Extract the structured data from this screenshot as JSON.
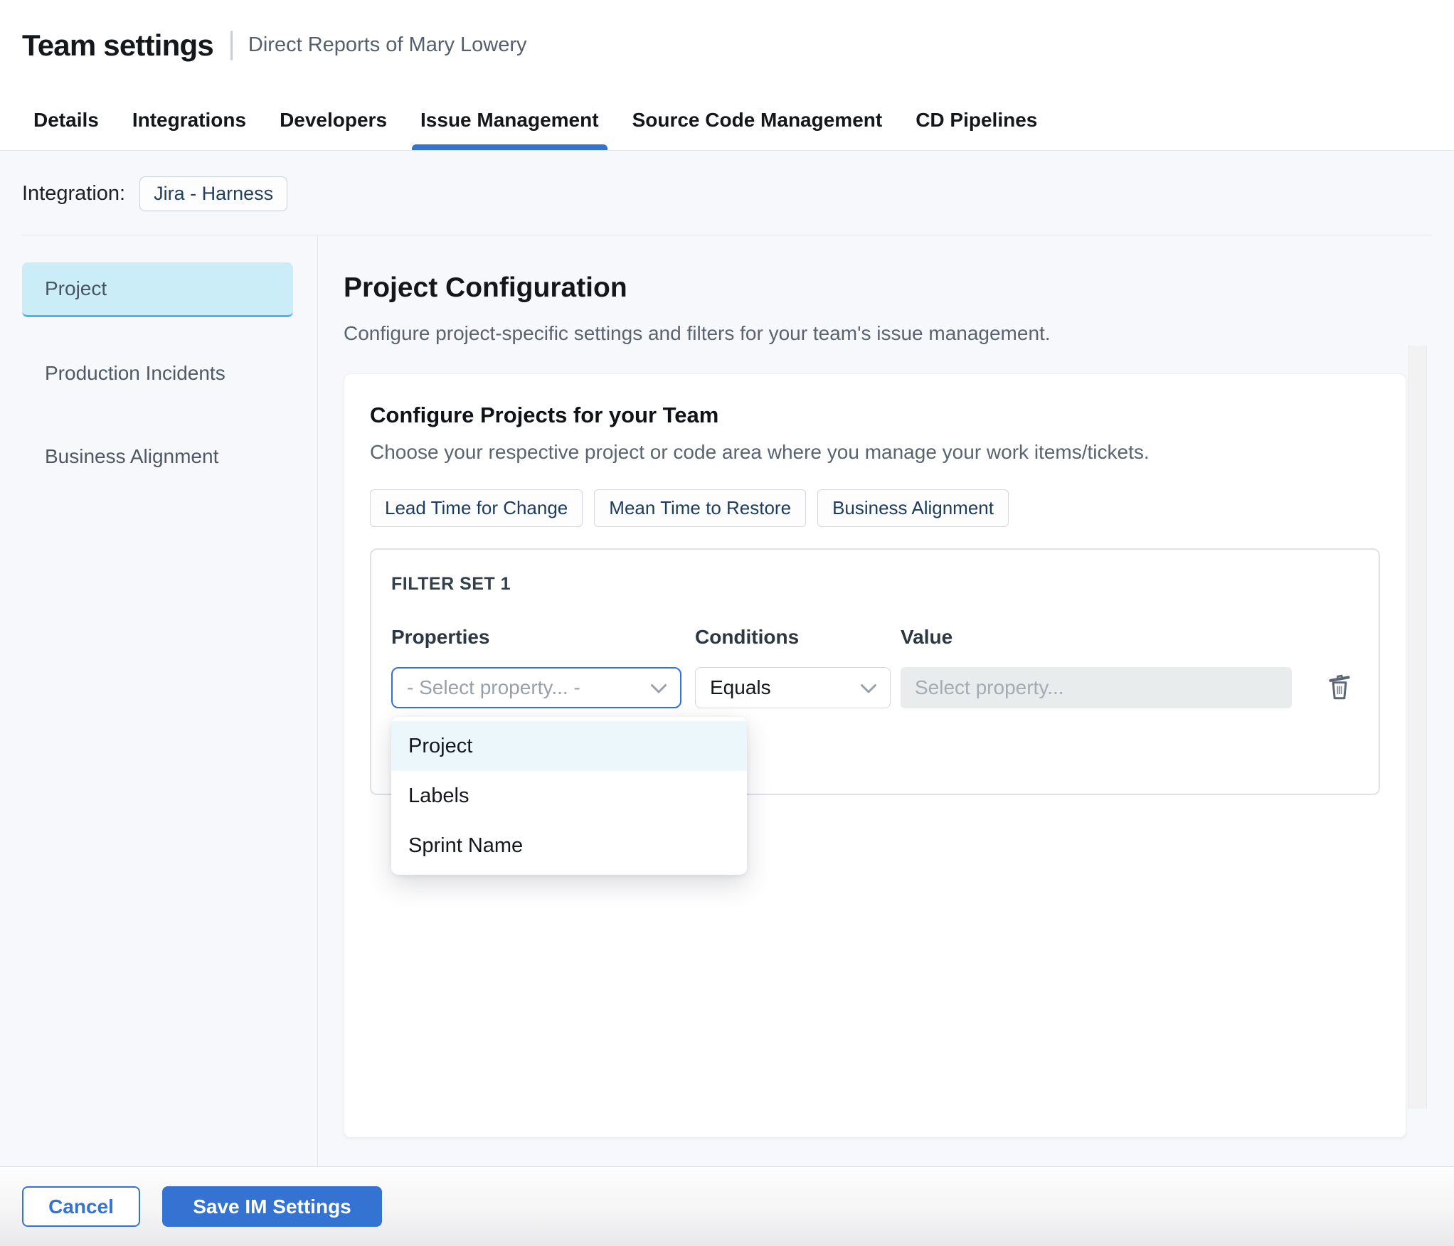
{
  "header": {
    "title": "Team settings",
    "subtitle": "Direct Reports of Mary Lowery"
  },
  "tabs": [
    {
      "label": "Details",
      "active": false
    },
    {
      "label": "Integrations",
      "active": false
    },
    {
      "label": "Developers",
      "active": false
    },
    {
      "label": "Issue Management",
      "active": true
    },
    {
      "label": "Source Code Management",
      "active": false
    },
    {
      "label": "CD Pipelines",
      "active": false
    }
  ],
  "integration": {
    "label": "Integration:",
    "chip": "Jira - Harness"
  },
  "sidebar": {
    "items": [
      {
        "label": "Project",
        "active": true
      },
      {
        "label": "Production Incidents",
        "active": false
      },
      {
        "label": "Business Alignment",
        "active": false
      }
    ]
  },
  "main": {
    "title": "Project Configuration",
    "subtitle": "Configure project-specific settings and filters for your team's issue management.",
    "card": {
      "title": "Configure Projects for your Team",
      "subtitle": "Choose your respective project or code area where you manage your work items/tickets.",
      "chips": [
        "Lead Time for Change",
        "Mean Time to Restore",
        "Business Alignment"
      ],
      "filter": {
        "title": "FILTER SET 1",
        "columns": [
          "Properties",
          "Conditions",
          "Value"
        ],
        "properties_placeholder": "- Select property... -",
        "conditions_value": "Equals",
        "value_placeholder": "Select property...",
        "dropdown": {
          "items": [
            "Project",
            "Labels",
            "Sprint Name"
          ],
          "highlighted": "Project"
        }
      }
    }
  },
  "footer": {
    "cancel_label": "Cancel",
    "save_label": "Save IM Settings"
  },
  "icons": {
    "properties_select": "chevron-down-icon",
    "conditions_select": "chevron-down-icon",
    "delete_filter": "trash-icon"
  },
  "colors": {
    "accent": "#3473d2",
    "content_bg": "#f7f8fb",
    "sidebar_active_bg": "#cbedf8",
    "sidebar_active_border": "#58b1dd",
    "dropdown_highlight": "#ecf7fb",
    "disabled_input_bg": "#e8eced"
  }
}
